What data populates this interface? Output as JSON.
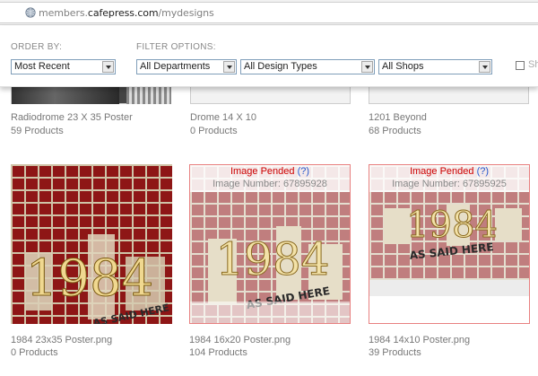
{
  "browser": {
    "url_prefix": "members.",
    "url_domain": "cafepress.com",
    "url_path": "/mydesigns"
  },
  "filters": {
    "order_by_label": "ORDER BY:",
    "filter_options_label": "FILTER OPTIONS:",
    "order_by_value": "Most Recent",
    "departments_value": "All Departments",
    "design_types_value": "All Design Types",
    "shops_value": "All Shops",
    "checkbox_label": "Sh"
  },
  "designs_top": [
    {
      "title": "Radiodrome 23 X 35 Poster",
      "count": "59 Products"
    },
    {
      "title": "Drome 14 X 10",
      "count": "0 Products"
    },
    {
      "title": "1201 Beyond",
      "count": "68 Products"
    }
  ],
  "designs_bottom": [
    {
      "title": "1984 23x35 Poster.png",
      "count": "0 Products",
      "pended": false
    },
    {
      "title": "1984 16x20 Poster.png",
      "count": "104 Products",
      "pended": true
    },
    {
      "title": "1984 14x10 Poster.png",
      "count": "39 Products",
      "pended": true
    }
  ],
  "pended": {
    "label": "Image Pended",
    "help": "(?)",
    "number_label_1": "Image Number: 67895928",
    "number_label_2": "Image Number: 67895925"
  },
  "artwork": {
    "year_text": "1984",
    "tag_text": "AS SAID HERE"
  },
  "colors": {
    "brick_red": "#8e1616",
    "mortar": "#cfc4a8",
    "pended_red": "#cc0000",
    "help_blue": "#2255cc"
  }
}
